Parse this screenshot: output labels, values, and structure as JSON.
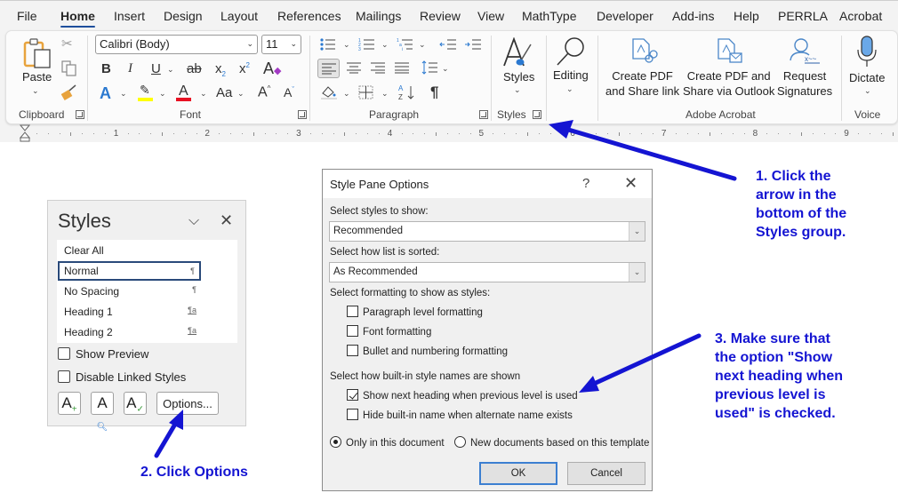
{
  "tabs": [
    {
      "label": "File",
      "active": false
    },
    {
      "label": "Home",
      "active": true
    },
    {
      "label": "Insert",
      "active": false
    },
    {
      "label": "Design",
      "active": false
    },
    {
      "label": "Layout",
      "active": false
    },
    {
      "label": "References",
      "active": false
    },
    {
      "label": "Mailings",
      "active": false
    },
    {
      "label": "Review",
      "active": false
    },
    {
      "label": "View",
      "active": false
    },
    {
      "label": "MathType",
      "active": false
    },
    {
      "label": "Developer",
      "active": false
    },
    {
      "label": "Add-ins",
      "active": false
    },
    {
      "label": "Help",
      "active": false
    },
    {
      "label": "PERRLA",
      "active": false
    },
    {
      "label": "Acrobat",
      "active": false
    }
  ],
  "ribbon": {
    "clipboard": {
      "label": "Clipboard",
      "paste_label": "Paste",
      "icons": [
        "paste-icon",
        "cut-icon",
        "copy-icon",
        "format-painter-icon"
      ]
    },
    "font": {
      "label": "Font",
      "font_name": "Calibri (Body)",
      "font_size": "11",
      "bold": "B",
      "italic": "I",
      "underline": "U",
      "strikethrough": "ab",
      "subscript": "x",
      "superscript": "x",
      "text_effects": "A",
      "font_color": "A",
      "change_case": "Aa",
      "grow_font": "A",
      "shrink_font": "A",
      "highlight_color": "#ffff00",
      "font_color_value": "#e81123"
    },
    "paragraph": {
      "label": "Paragraph",
      "pilcrow": "¶"
    },
    "styles": {
      "label": "Styles",
      "button_label": "Styles"
    },
    "editing": {
      "button_label": "Editing"
    },
    "adobe": {
      "label": "Adobe Acrobat",
      "create_share_link": "Create PDF\nand Share link",
      "create_share_outlook": "Create PDF and\nShare via Outlook",
      "request_signatures": "Request\nSignatures"
    },
    "voice": {
      "label": "Voice",
      "dictate_label": "Dictate"
    }
  },
  "ruler": {
    "numbers": [
      "1",
      "2",
      "3",
      "4",
      "5",
      "6",
      "7",
      "8",
      "9"
    ]
  },
  "styles_pane": {
    "title": "Styles",
    "items": [
      {
        "label": "Clear All",
        "mark": "",
        "selected": false
      },
      {
        "label": "Normal",
        "mark": "¶",
        "selected": true
      },
      {
        "label": "No Spacing",
        "mark": "¶",
        "selected": false
      },
      {
        "label": "Heading 1",
        "mark": "¶a",
        "selected": false
      },
      {
        "label": "Heading 2",
        "mark": "¶a",
        "selected": false
      }
    ],
    "show_preview": {
      "label": "Show Preview",
      "checked": false
    },
    "disable_linked": {
      "label": "Disable Linked Styles",
      "checked": false
    },
    "options_button": "Options..."
  },
  "dialog": {
    "title": "Style Pane Options",
    "help": "?",
    "select_styles_label": "Select styles to show:",
    "select_styles_value": "Recommended",
    "sort_label": "Select how list is sorted:",
    "sort_value": "As Recommended",
    "formatting_label": "Select formatting to show as styles:",
    "formatting_options": [
      {
        "label": "Paragraph level formatting",
        "checked": false
      },
      {
        "label": "Font formatting",
        "checked": false
      },
      {
        "label": "Bullet and numbering formatting",
        "checked": false
      }
    ],
    "builtin_label": "Select how built-in style names are shown",
    "builtin_options": [
      {
        "label": "Show next heading when previous level is used",
        "checked": true
      },
      {
        "label": "Hide built-in name when alternate name exists",
        "checked": false
      }
    ],
    "scope_options": [
      {
        "label": "Only in this document",
        "selected": true
      },
      {
        "label": "New documents based on this template",
        "selected": false
      }
    ],
    "ok_label": "OK",
    "cancel_label": "Cancel"
  },
  "annotations": {
    "step1": "1. Click the\narrow in the\nbottom of the\nStyles group.",
    "step2": "2. Click Options",
    "step3": "3. Make sure that\nthe option \"Show\nnext heading when\nprevious level is\nused\" is checked.",
    "color": "#1414d2"
  }
}
